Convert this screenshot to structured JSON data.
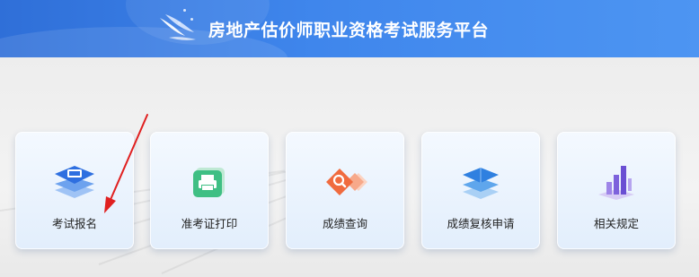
{
  "header": {
    "title": "房地产估价师职业资格考试服务平台",
    "logo_icon": "paper-plane-logo-icon",
    "colors": {
      "start": "#2f6fd8",
      "end": "#4d95f2"
    }
  },
  "cards": [
    {
      "label": "考试报名",
      "icon": "exam-registration-icon"
    },
    {
      "label": "准考证打印",
      "icon": "printer-icon"
    },
    {
      "label": "成绩查询",
      "icon": "search-icon"
    },
    {
      "label": "成绩复核申请",
      "icon": "layers-icon"
    },
    {
      "label": "相关规定",
      "icon": "bar-chart-icon"
    }
  ],
  "annotation": {
    "type": "red-arrow",
    "points_to": "考试报名",
    "color": "#e02020"
  }
}
